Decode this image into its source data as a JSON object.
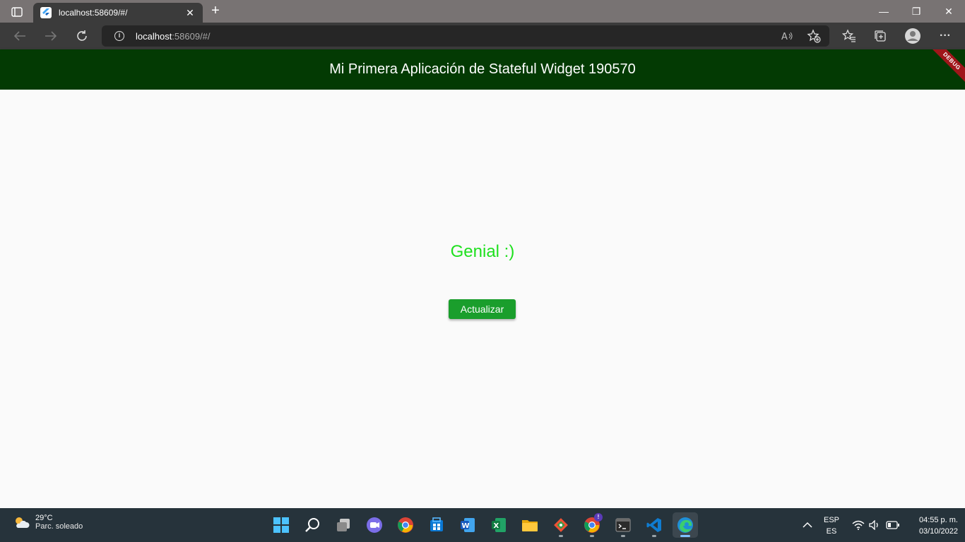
{
  "browser": {
    "tab_title": "localhost:58609/#/",
    "close_tab": "✕",
    "new_tab": "+",
    "minimize": "—",
    "restore": "❐",
    "close_window": "✕",
    "address_host": "localhost",
    "address_rest": ":58609/#/",
    "more": "···"
  },
  "app": {
    "title": "Mi Primera Aplicación de Stateful Widget 190570",
    "debug_banner": "DEBUG",
    "message": "Genial :)",
    "message_color": "#1ee01e",
    "button_label": "Actualizar",
    "appbar_color": "#033a03",
    "button_color": "#1a9e2c"
  },
  "taskbar": {
    "weather_temp": "29°C",
    "weather_condition": "Parc. soleado",
    "apps": [
      "start-icon",
      "search-icon",
      "task-view-icon",
      "chat-icon",
      "chrome-icon",
      "store-icon",
      "word-icon",
      "excel-icon",
      "file-explorer-icon",
      "git-icon",
      "chrome-profile-icon",
      "terminal-icon",
      "vscode-icon",
      "edge-icon"
    ],
    "chrome_badge": "!",
    "lang_top": "ESP",
    "lang_bottom": "ES",
    "time": "04:55 p. m.",
    "date": "03/10/2022"
  }
}
